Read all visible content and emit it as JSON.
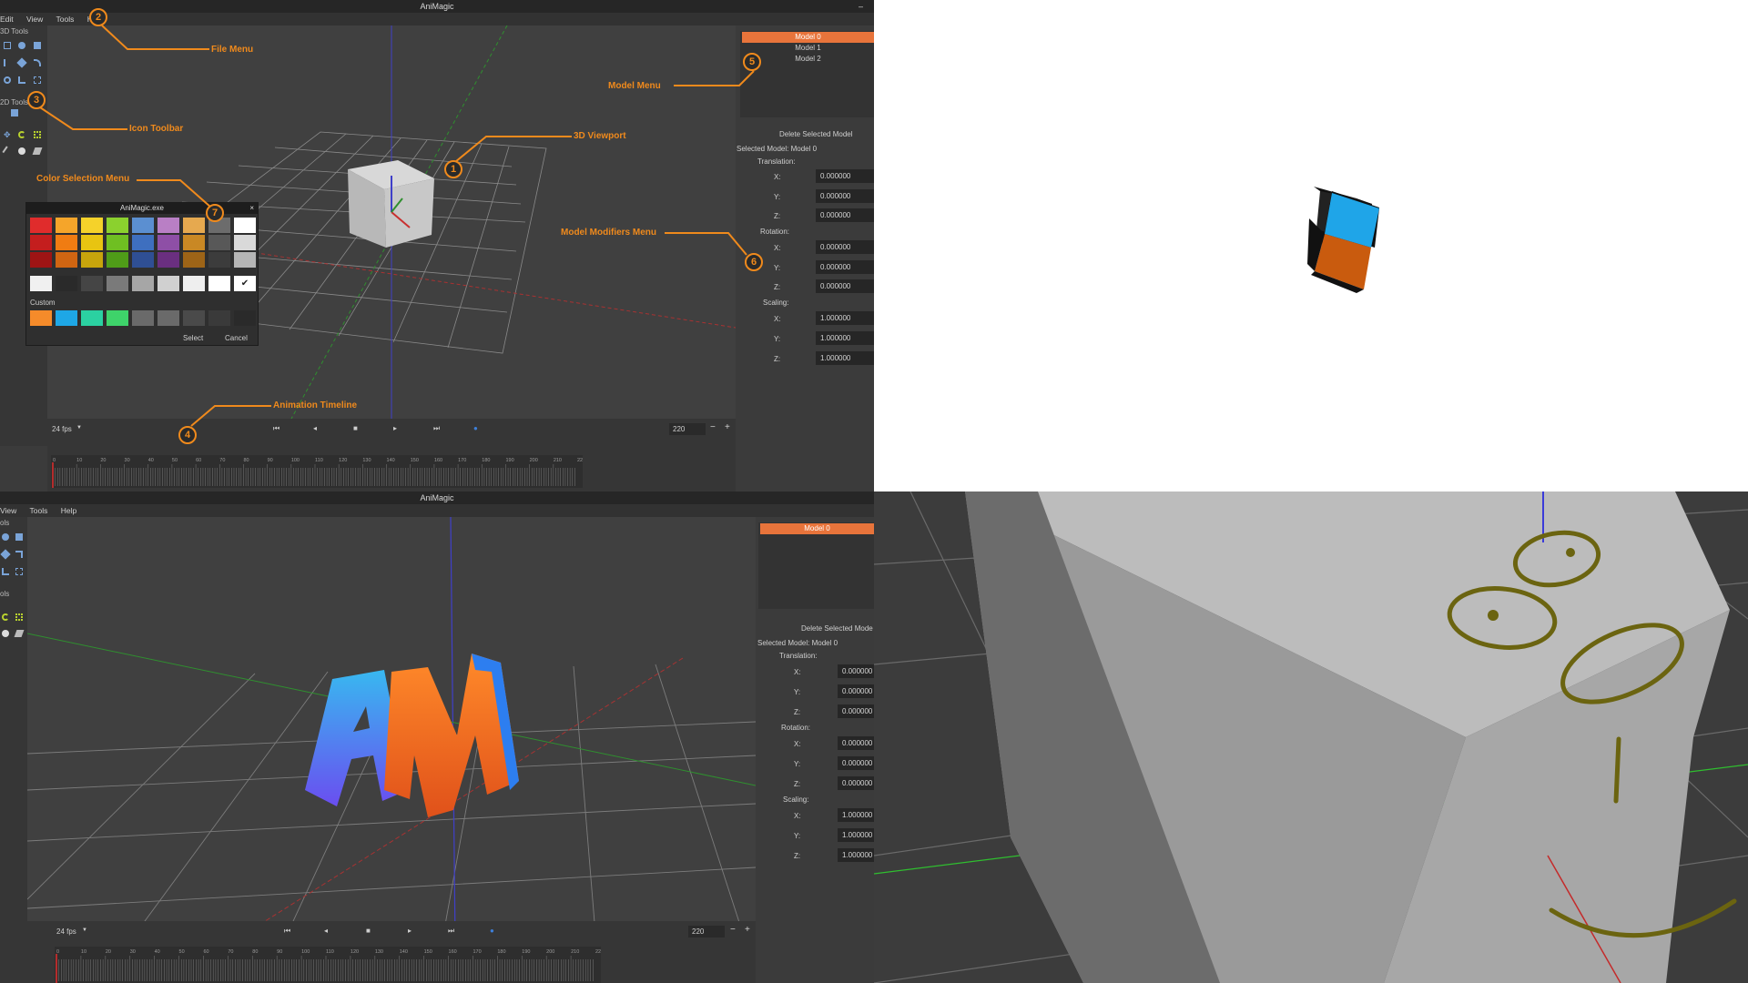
{
  "app": {
    "title": "AniMagic",
    "minimize": "–",
    "menu": [
      "Edit",
      "View",
      "Tools",
      "Help"
    ],
    "menu2": [
      "View",
      "Tools",
      "Help"
    ]
  },
  "toolbar": {
    "label_3d": "3D Tools",
    "label_2d": "2D Tools",
    "label_3d_cut": "ols",
    "label_2d_cut": "ols"
  },
  "annotations": [
    {
      "num": "1",
      "label": "3D Viewport"
    },
    {
      "num": "2",
      "label": "File Menu"
    },
    {
      "num": "3",
      "label": "Icon Toolbar"
    },
    {
      "num": "4",
      "label": "Animation Timeline"
    },
    {
      "num": "5",
      "label": "Model Menu"
    },
    {
      "num": "6",
      "label": "Model Modifiers Menu"
    },
    {
      "num": "7",
      "label": "Color Selection Menu"
    }
  ],
  "models": {
    "items": [
      "Model 0",
      "Model 1",
      "Model 2"
    ],
    "items2": [
      "Model 0"
    ],
    "delete_label": "Delete Selected Model",
    "delete_label2": "Delete Selected Mode",
    "selected_label": "Selected Model: Model 0",
    "translation": "Translation:",
    "rotation": "Rotation:",
    "scaling": "Scaling:",
    "x": "X:",
    "y": "Y:",
    "z": "Z:",
    "zero": "0.000000",
    "one": "1.000000"
  },
  "color_dialog": {
    "title": "AniMagic.exe",
    "close": "×",
    "custom_label": "Custom",
    "select": "Select",
    "cancel": "Cancel",
    "check": "✔",
    "rows": [
      [
        "#e02c2c",
        "#f5a52a",
        "#f5d22a",
        "#8bd12e",
        "#5b8fd1",
        "#b97fc5",
        "#e6a94f",
        "#6c6c6c",
        "#ffffff"
      ],
      [
        "#c41e1e",
        "#f07c12",
        "#e8c411",
        "#6fbf22",
        "#3e6fbf",
        "#8e4fa6",
        "#c98824",
        "#585858",
        "#d9d9d9"
      ],
      [
        "#9e1414",
        "#d06512",
        "#c7a40c",
        "#4f9c18",
        "#2f4f94",
        "#6a2f80",
        "#9d6417",
        "#3c3c3c",
        "#b5b5b5"
      ]
    ],
    "grays": [
      "#f0f0f0",
      "#2a2a2a",
      "#454545",
      "#7a7a7a",
      "#a6a6a6",
      "#d0d0d0",
      "#eeeeee",
      "#ffffff"
    ],
    "custom": [
      "#f58b2a",
      "#1ea7e6",
      "#2bd1a1",
      "#3ed36a",
      "#6a6a6a",
      "#6a6a6a",
      "#4a4a4a",
      "#3a3a3a",
      "#2a2a2a"
    ]
  },
  "timeline": {
    "fps": "24 fps",
    "frame": "220",
    "minus": "−",
    "plus": "+",
    "ticks": [
      "0",
      "10",
      "20",
      "30",
      "40",
      "50",
      "60",
      "70",
      "80",
      "90",
      "100",
      "110",
      "120",
      "130",
      "140",
      "150",
      "160",
      "170",
      "180",
      "190",
      "200",
      "210",
      "220"
    ],
    "transport": [
      "⏮",
      "◂",
      "■",
      "▸",
      "⏭",
      "●"
    ]
  },
  "colors": {
    "accent": "#e8743b",
    "annotation": "#f08a1c",
    "cube_top": "#1fa5e8",
    "cube_side": "#c95b0e",
    "drawing": "#6b6410"
  }
}
